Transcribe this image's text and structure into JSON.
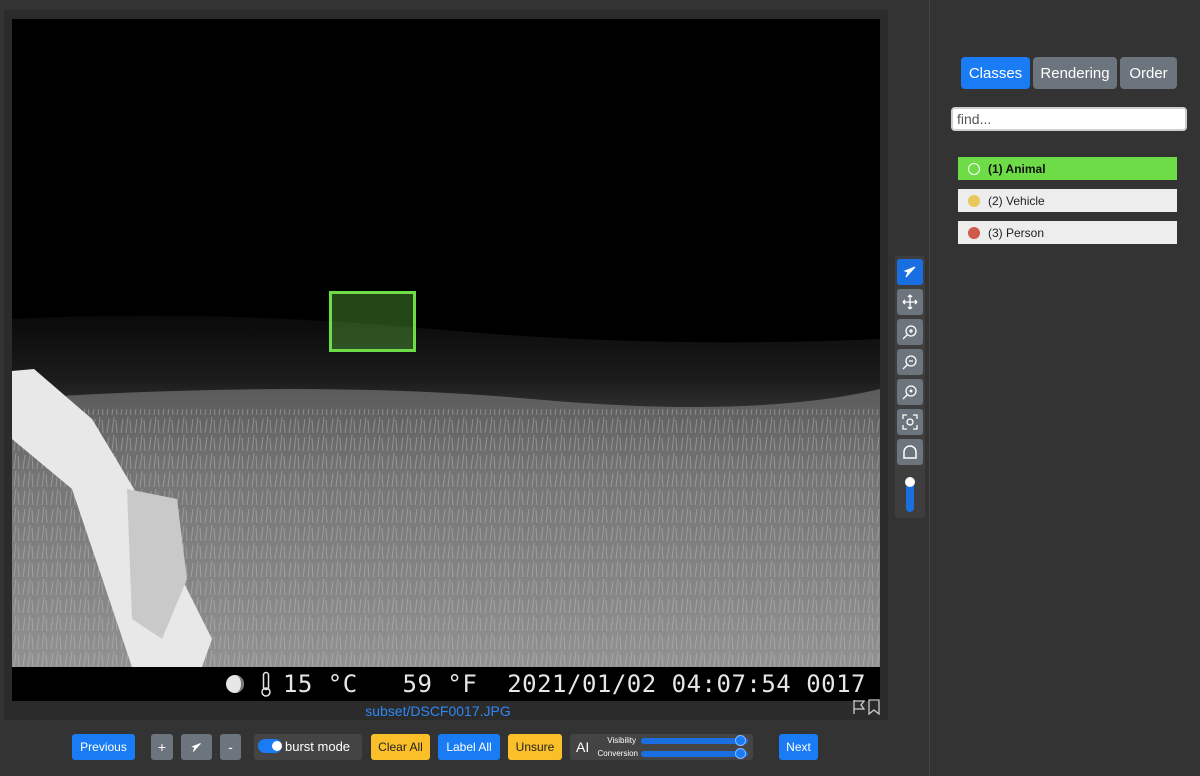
{
  "viewer": {
    "filename": "subset/DSCF0017.JPG",
    "stamp": {
      "temp_c": "15 °C",
      "temp_f": "59 °F",
      "date": "2021/01/02",
      "time": "04:07:54",
      "frame": "0017"
    },
    "annotation": {
      "class": "(1) Animal",
      "color": "#6ddc47"
    }
  },
  "tools": [
    {
      "icon": "pointer-icon",
      "active": true
    },
    {
      "icon": "move-icon",
      "active": false
    },
    {
      "icon": "zoom-in-icon",
      "active": false
    },
    {
      "icon": "zoom-out-icon",
      "active": false
    },
    {
      "icon": "zoom-reset-icon",
      "active": false
    },
    {
      "icon": "zoom-fit-icon",
      "active": false
    },
    {
      "icon": "shape-icon",
      "active": false
    },
    {
      "icon": "opacity-slider",
      "active": false
    }
  ],
  "sidebar": {
    "tabs": [
      {
        "label": "Classes",
        "active": true
      },
      {
        "label": "Rendering",
        "active": false
      },
      {
        "label": "Order",
        "active": false
      }
    ],
    "search_placeholder": "find...",
    "classes": [
      {
        "label": "(1) Animal",
        "color": "#6ddc47",
        "selected": true
      },
      {
        "label": "(2) Vehicle",
        "color": "#e8c85a",
        "selected": false
      },
      {
        "label": "(3) Person",
        "color": "#cf5a4a",
        "selected": false
      }
    ]
  },
  "toolbar": {
    "previous": "Previous",
    "plus": "+",
    "minus": "-",
    "burst_mode": "burst mode",
    "burst_enabled": true,
    "clear_all": "Clear All",
    "label_all": "Label All",
    "unsure": "Unsure",
    "ai": "AI",
    "visibility": "Visibility",
    "conversion": "Conversion",
    "visibility_level": 0.95,
    "conversion_level": 0.95,
    "next": "Next"
  },
  "colors": {
    "primary": "#1a7cf5",
    "secondary": "#6c757d",
    "warning": "#fbbf2a",
    "background": "#333333"
  }
}
